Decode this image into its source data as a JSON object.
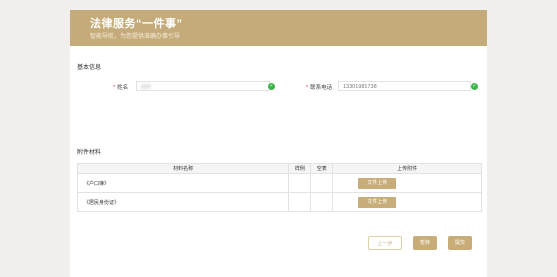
{
  "banner": {
    "title": "法律服务“一件事”",
    "subtitle": "智能导航，为您提供准确办事引导"
  },
  "basic_info": {
    "section_title": "基本信息",
    "name_label": "姓名",
    "name_value": "",
    "phone_label": "联系电话",
    "phone_value": "13301981738"
  },
  "attachments": {
    "section_title": "附件材料",
    "columns": [
      "材料名称",
      "样例",
      "空表",
      "上传附件"
    ],
    "rows": [
      {
        "name": "《户口簿》",
        "button": "文件上传"
      },
      {
        "name": "《居民身份证》",
        "button": "文件上传"
      }
    ]
  },
  "actions": {
    "prev": "上一步",
    "save": "暂存",
    "submit": "提交"
  },
  "colors": {
    "brand": "#c4ab79",
    "valid": "#3bb54a"
  }
}
